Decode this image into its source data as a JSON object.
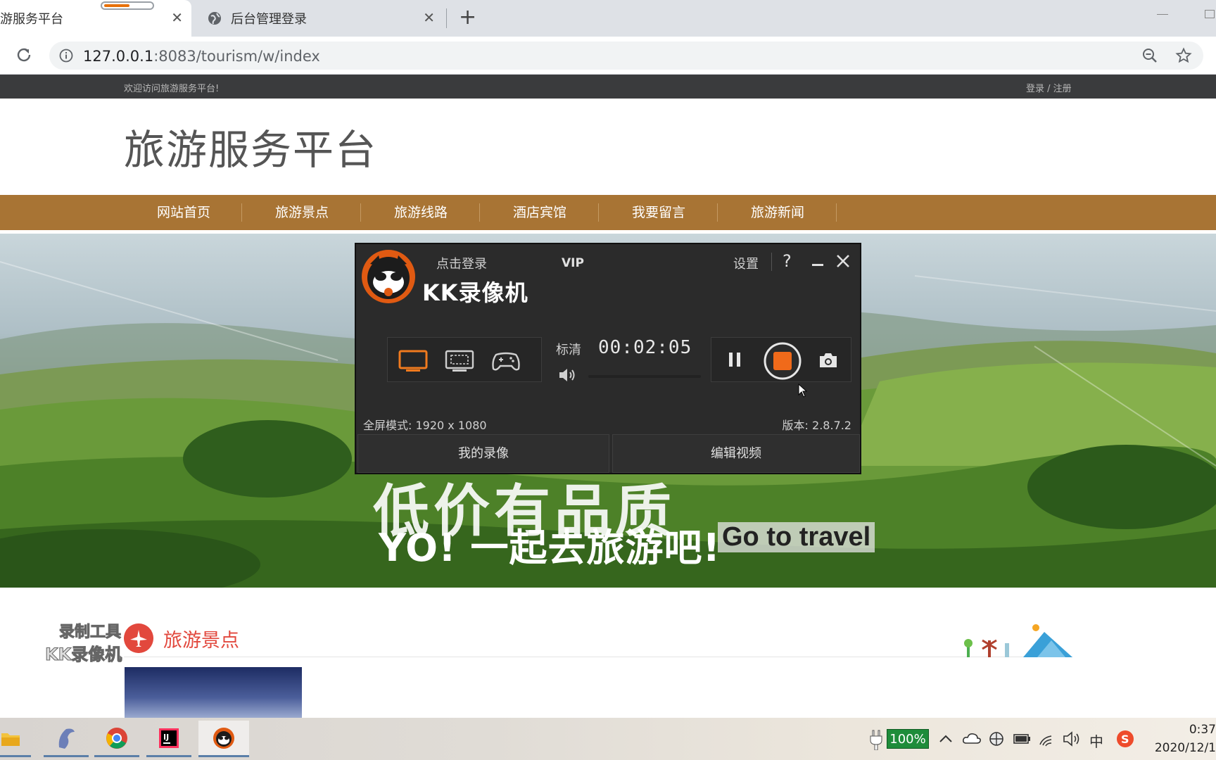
{
  "browser": {
    "tabs": [
      {
        "title": "旅游服务平台",
        "active": true
      },
      {
        "title": "后台管理登录",
        "active": false
      }
    ],
    "url_host": "127.0.0.1",
    "url_rest": ":8083/tourism/w/index",
    "new_tab": "+"
  },
  "site": {
    "welcome": "欢迎访问旅游服务平台!",
    "login": "登录 / 注册",
    "title": "旅游服务平台",
    "nav": [
      "网站首页",
      "旅游景点",
      "旅游线路",
      "酒店宾馆",
      "我要留言",
      "旅游新闻"
    ],
    "hero": {
      "line1": "低价有品质",
      "line2": "YO! 一起去旅游吧!",
      "line3": "Go to travel"
    },
    "section_title": "旅游景点",
    "watermark": {
      "line1": "录制工具",
      "line2": "KK录像机"
    }
  },
  "recorder": {
    "login": "点击登录",
    "vip": "VIP",
    "settings": "设置",
    "help": "?",
    "brand": "KK录像机",
    "quality": "标清",
    "timer": "00:02:05",
    "fullscreen_mode": "全屏模式: 1920 x 1080",
    "version": "版本: 2.8.7.2",
    "my_recordings": "我的录像",
    "edit_video": "编辑视频"
  },
  "taskbar": {
    "battery": "100%",
    "ime": "中",
    "time": "0:37",
    "date": "2020/12/1"
  },
  "colors": {
    "nav_bg": "#a87434",
    "topbar_bg": "#3a3b3d",
    "accent_red": "#e2483d",
    "recorder_bg": "#2b2b2b",
    "record_orange": "#f06a1a"
  }
}
